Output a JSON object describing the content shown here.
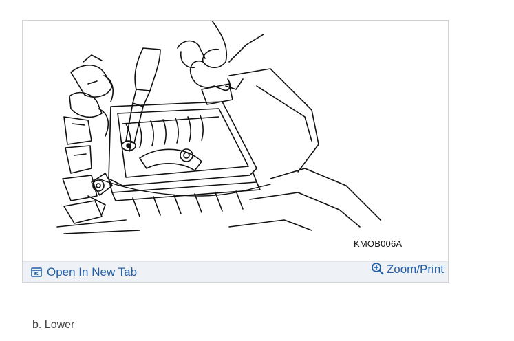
{
  "figure": {
    "code": "KMOB006A",
    "image_subject": "technician hand with socket wrench removing bolts from engine air cleaner housing lower case",
    "open_tab_label": "Open In New Tab",
    "open_tab_icon": "open-in-new-tab-icon",
    "zoom_label": "Zoom/Print",
    "zoom_icon": "zoom-in-icon",
    "link_color": "#1f5fa8",
    "toolbar_bg": "#eef1f6"
  },
  "caption": "b. Lower"
}
